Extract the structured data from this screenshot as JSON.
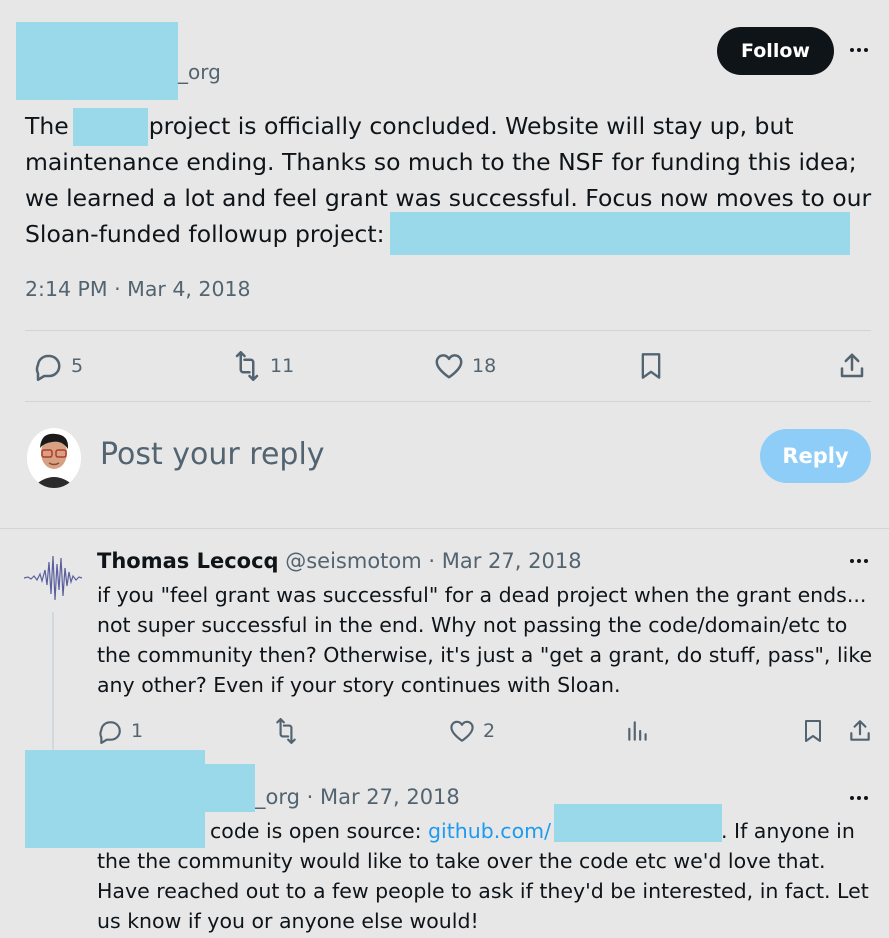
{
  "post": {
    "handle_suffix": "_org",
    "follow_label": "Follow",
    "text_1": "The",
    "text_2": "project is officially concluded. Website will stay up, but maintenance ending. Thanks so much to the NSF for funding this idea; we learned a lot and feel grant was successful. Focus now moves to our Sloan-funded followup project:",
    "timestamp": "2:14 PM · Mar 4, 2018",
    "stats": {
      "replies": "5",
      "reposts": "11",
      "likes": "18"
    }
  },
  "composer": {
    "placeholder": "Post your reply",
    "reply_label": "Reply"
  },
  "replies": [
    {
      "name": "Thomas Lecocq",
      "handle_date": "@seismotom · Mar 27, 2018",
      "text": "if you \"feel grant was successful\" for a dead project when the grant ends... not super successful in the end. Why not passing the code/domain/etc to the community then? Otherwise, it's just a \"get a grant, do stuff, pass\", like any other? Even if your story continues with Sloan.",
      "stats": {
        "replies": "1",
        "likes": "2"
      }
    },
    {
      "handle_suffix_date": "_org · Mar 27, 2018",
      "text_1": "code is open source:",
      "link": "github.com/",
      "text_2": ". If anyone in",
      "text_3": "the the community would like to take over the code etc we'd love that. Have reached out to a few people to ask if they'd be interested, in fact.  Let us know if you or anyone else would!"
    }
  ],
  "colors": {
    "background": "#e7e7e7",
    "text": "#0f1419",
    "muted": "#536471",
    "link": "#1d9bf0",
    "reply_button": "#8ecdf8",
    "redaction": "#9ad9ea"
  }
}
